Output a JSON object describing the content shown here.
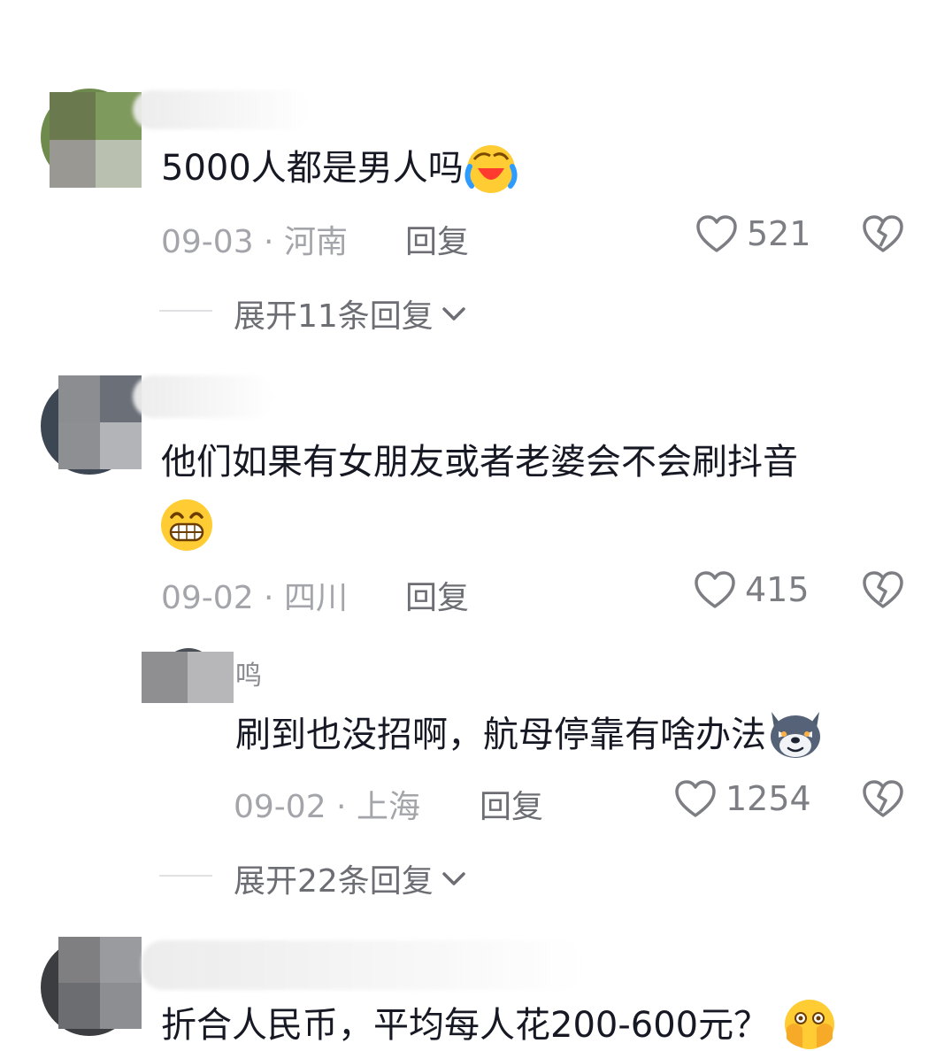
{
  "comments": [
    {
      "text": "5000人都是男人吗",
      "emoji": "laughing-crying-emoji",
      "date": "09-03",
      "location": "河南",
      "reply_label": "回复",
      "likes": "521",
      "expand_label": "展开11条回复"
    },
    {
      "text": "他们如果有女朋友或者老婆会不会刷抖音",
      "emoji": "grinning-teeth-emoji",
      "date": "09-02",
      "location": "四川",
      "reply_label": "回复",
      "likes": "415",
      "sub_reply": {
        "name_fragment": "鸣",
        "text": "刷到也没招啊，航母停靠有啥办法",
        "emoji": "smirking-wolf-emoji",
        "date": "09-02",
        "location": "上海",
        "reply_label": "回复",
        "likes": "1254"
      },
      "expand_label": "展开22条回复"
    },
    {
      "text": "折合人民币，平均每人花200-600元？",
      "emoji": "covering-face-emoji"
    }
  ],
  "separator": " · ",
  "icons": {
    "like": "heart-outline-icon",
    "dislike": "broken-heart-icon",
    "expand": "chevron-down-icon"
  }
}
